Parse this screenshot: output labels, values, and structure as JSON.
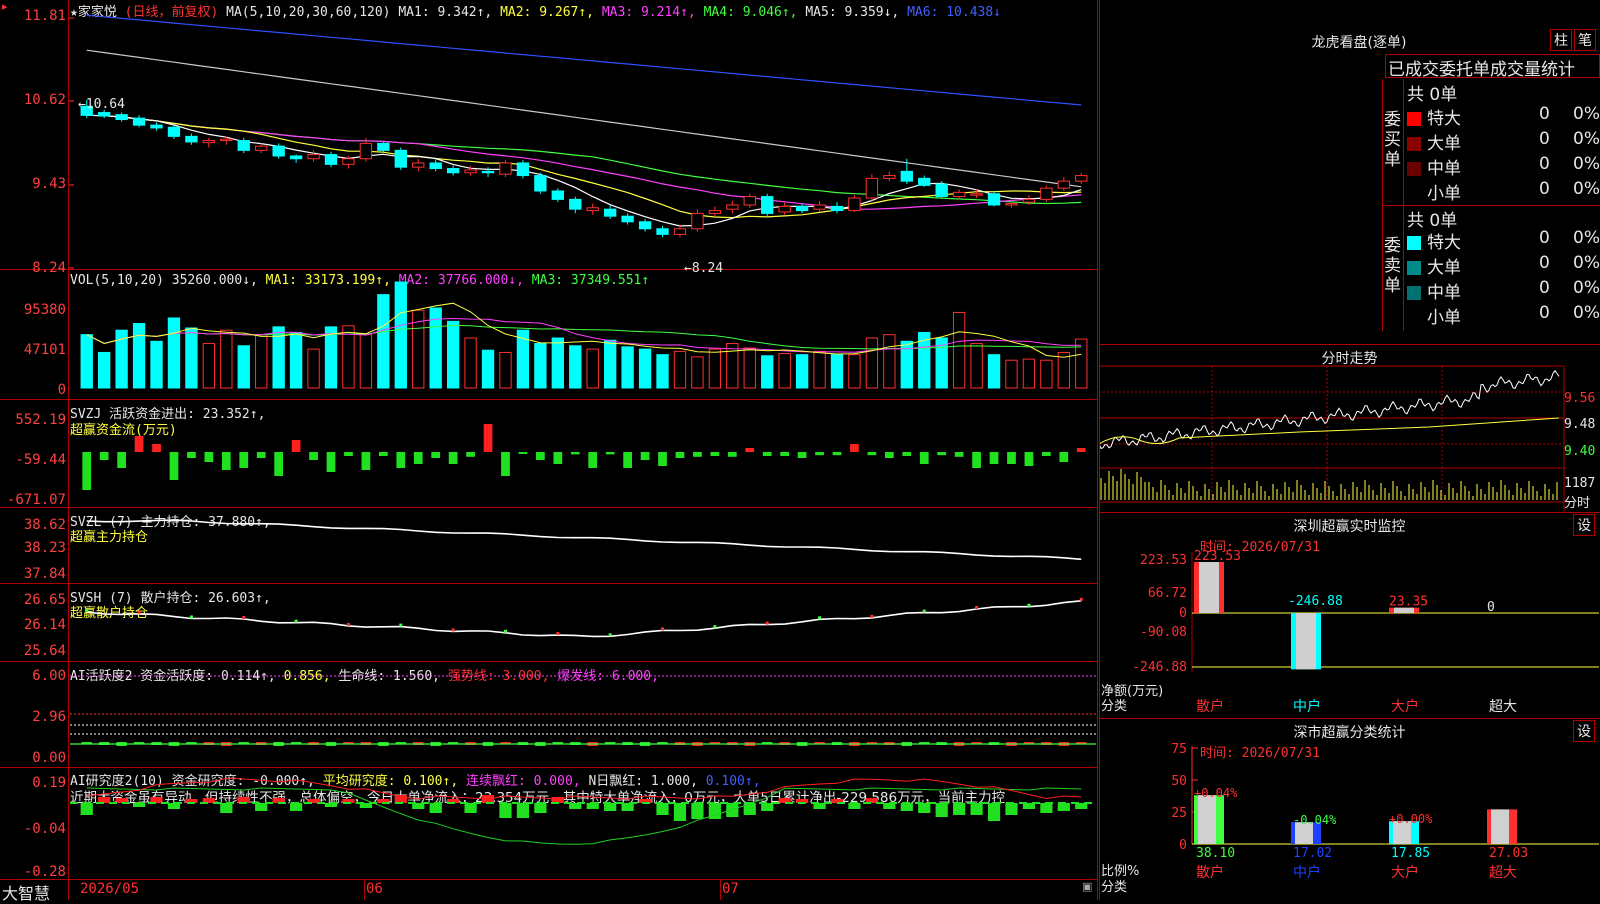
{
  "chart_header": {
    "stock_name": "★家家悦",
    "period": "(日线，前复权)",
    "ma_spec": "MA(5,10,20,30,60,120)",
    "ma_items": [
      {
        "label": "MA1: 9.342↑,",
        "color": "#e6e6e6"
      },
      {
        "label": "MA2: 9.267↑,",
        "color": "#ffff40"
      },
      {
        "label": "MA3: 9.214↑,",
        "color": "#ff40ff"
      },
      {
        "label": "MA4: 9.046↑,",
        "color": "#40ff40"
      },
      {
        "label": "MA5: 9.359↓,",
        "color": "#e6e6e6"
      },
      {
        "label": "MA6: 10.438↓",
        "color": "#4060ff"
      }
    ]
  },
  "price_axis": [
    "11.81",
    "10.62",
    "9.43",
    "8.24"
  ],
  "price_annotations": {
    "high": "←10.64",
    "low": "←8.24"
  },
  "vol_header": {
    "spec": "VOL(5,10,20)",
    "items": [
      {
        "label": "35260.000↓,",
        "color": "#e6e6e6"
      },
      {
        "label": "MA1: 33173.199↑,",
        "color": "#ffff40"
      },
      {
        "label": "MA2: 37766.000↓,",
        "color": "#ff40ff"
      },
      {
        "label": "MA3: 37349.551↑",
        "color": "#40ff40"
      }
    ]
  },
  "vol_axis": [
    "95380",
    "47101",
    "0"
  ],
  "svzj": {
    "title": "SVZJ  活跃资金进出: 23.352↑,",
    "sub": "超赢资金流(万元)",
    "axis": [
      "552.19",
      "-59.44",
      "-671.07"
    ]
  },
  "svzl": {
    "title": "SVZL (7) 主力持仓: 37.880↑,",
    "sub": "超赢主力持仓",
    "axis": [
      "38.62",
      "38.23",
      "37.84"
    ]
  },
  "svsh": {
    "title": "SVSH (7) 散户持仓: 26.603↑,",
    "sub": "超赢散户持仓",
    "axis": [
      "26.65",
      "26.14",
      "25.64"
    ]
  },
  "ai1": {
    "items": [
      {
        "label": "AI活跃度2 资金活跃度: 0.114↑,",
        "color": "#e6e6e6"
      },
      {
        "label": "0.856,",
        "color": "#ffff40"
      },
      {
        "label": "生命线: 1.560,",
        "color": "#e6e6e6"
      },
      {
        "label": "强势线: 3.000,",
        "color": "#ff3030"
      },
      {
        "label": "爆发线: 6.000,",
        "color": "#ff40ff"
      }
    ],
    "axis": [
      "6.00",
      "2.96",
      "0.00"
    ]
  },
  "ai2": {
    "items": [
      {
        "label": "AI研究度2(10) 资金研究度: -0.000↑,",
        "color": "#e6e6e6"
      },
      {
        "label": "平均研究度: 0.100↑,",
        "color": "#ffff40"
      },
      {
        "label": "连续飘红: 0.000,",
        "color": "#ff40ff"
      },
      {
        "label": "N日飘红: 1.000,",
        "color": "#e6e6e6"
      },
      {
        "label": "0.100↑,",
        "color": "#4060ff"
      }
    ],
    "note": "近期大资金虽有异动，但持续性不强，总体偏空，今日大单净流入：23.354万元，其中特大单净流入：0万元，大单5日累计净出-229.586万元，当前主力控",
    "axis": [
      "0.19",
      "-0.04",
      "-0.28"
    ]
  },
  "date_axis": {
    "brand": "大智慧",
    "labels": [
      "2026/05",
      "06",
      "07"
    ]
  },
  "right": {
    "title": "龙虎看盘(逐单)",
    "btn1": "柱",
    "btn2": "笔",
    "tab_title": "已成交委托单成交量统计",
    "buy_label": "委买单",
    "sell_label": "委卖单",
    "buy_total": "共 0单",
    "sell_total": "共 0单",
    "buy_rows": [
      {
        "name": "特大",
        "v": "0",
        "p": "0%",
        "color": "#ff0000"
      },
      {
        "name": "大单",
        "v": "0",
        "p": "0%",
        "color": "#8a0000"
      },
      {
        "name": "中单",
        "v": "0",
        "p": "0%",
        "color": "#6a0000"
      },
      {
        "name": "小单",
        "v": "0",
        "p": "0%",
        "color": "#000000"
      }
    ],
    "sell_rows": [
      {
        "name": "特大",
        "v": "0",
        "p": "0%",
        "color": "#00ffff"
      },
      {
        "name": "大单",
        "v": "0",
        "p": "0%",
        "color": "#008b8b"
      },
      {
        "name": "中单",
        "v": "0",
        "p": "0%",
        "color": "#007070"
      },
      {
        "name": "小单",
        "v": "0",
        "p": "0%",
        "color": "#000000"
      }
    ],
    "minute_title": "分时走势",
    "minute_axis": [
      "9.56",
      "9.48",
      "9.40"
    ],
    "minute_vol": "1187",
    "minute_vol_label": "分时",
    "monitor_title": "深圳超赢实时监控",
    "set1": "设",
    "monitor_time": "时间: 2026/07/31",
    "monitor_axis": [
      "223.53",
      "66.72",
      "0",
      "-90.08",
      "-246.88"
    ],
    "monitor_bar_labels": [
      "223.53",
      "-246.88",
      "23.35",
      "0"
    ],
    "monitor_ylabel": "净额(万元)",
    "monitor_xlabel": "分类",
    "categories": [
      "散户",
      "中户",
      "大户",
      "超大"
    ],
    "class_title": "深市超赢分类统计",
    "set2": "设",
    "class_time": "时间: 2026/07/31",
    "class_axis": [
      "75",
      "50",
      "25",
      "0"
    ],
    "class_pct": [
      "+0.04%",
      "-0.04%",
      "+0.00%",
      ""
    ],
    "class_values": [
      "38.10",
      "17.02",
      "17.85",
      "27.03"
    ],
    "class_ylabel": "比例%",
    "class_xlabel": "分类"
  },
  "chart_data": {
    "type": "candlestick",
    "candles": [
      [
        10.55,
        10.42,
        10.64,
        10.38
      ],
      [
        10.46,
        10.41,
        10.5,
        10.38
      ],
      [
        10.43,
        10.36,
        10.46,
        10.33
      ],
      [
        10.38,
        10.28,
        10.42,
        10.25
      ],
      [
        10.28,
        10.24,
        10.32,
        10.2
      ],
      [
        10.25,
        10.12,
        10.28,
        10.08
      ],
      [
        10.12,
        10.04,
        10.16,
        10.0
      ],
      [
        10.03,
        10.06,
        10.1,
        9.96
      ],
      [
        10.06,
        10.08,
        10.12,
        10.0
      ],
      [
        10.06,
        9.92,
        10.1,
        9.88
      ],
      [
        9.92,
        9.98,
        10.02,
        9.88
      ],
      [
        9.98,
        9.84,
        10.02,
        9.8
      ],
      [
        9.84,
        9.8,
        9.86,
        9.74
      ],
      [
        9.8,
        9.86,
        9.92,
        9.76
      ],
      [
        9.86,
        9.72,
        9.9,
        9.68
      ],
      [
        9.72,
        9.8,
        9.84,
        9.66
      ],
      [
        9.8,
        10.02,
        10.1,
        9.76
      ],
      [
        10.02,
        9.92,
        10.04,
        9.88
      ],
      [
        9.92,
        9.68,
        9.96,
        9.64
      ],
      [
        9.68,
        9.74,
        9.8,
        9.62
      ],
      [
        9.74,
        9.66,
        9.8,
        9.62
      ],
      [
        9.66,
        9.6,
        9.7,
        9.56
      ],
      [
        9.6,
        9.64,
        9.7,
        9.56
      ],
      [
        9.62,
        9.6,
        9.68,
        9.54
      ],
      [
        9.58,
        9.74,
        9.78,
        9.54
      ],
      [
        9.74,
        9.56,
        9.78,
        9.52
      ],
      [
        9.56,
        9.34,
        9.6,
        9.3
      ],
      [
        9.34,
        9.22,
        9.38,
        9.18
      ],
      [
        9.22,
        9.08,
        9.26,
        9.02
      ],
      [
        9.06,
        9.1,
        9.16,
        9.0
      ],
      [
        9.08,
        8.98,
        9.14,
        8.94
      ],
      [
        8.98,
        8.9,
        9.02,
        8.86
      ],
      [
        8.9,
        8.8,
        8.94,
        8.76
      ],
      [
        8.8,
        8.72,
        8.84,
        8.68
      ],
      [
        8.72,
        8.8,
        8.86,
        8.68
      ],
      [
        8.8,
        9.02,
        9.08,
        8.76
      ],
      [
        9.02,
        9.06,
        9.12,
        8.98
      ],
      [
        9.08,
        9.14,
        9.2,
        9.02
      ],
      [
        9.14,
        9.26,
        9.3,
        9.1
      ],
      [
        9.26,
        9.02,
        9.3,
        8.98
      ],
      [
        9.04,
        9.12,
        9.18,
        9.0
      ],
      [
        9.12,
        9.06,
        9.16,
        9.02
      ],
      [
        9.08,
        9.14,
        9.2,
        9.04
      ],
      [
        9.12,
        9.06,
        9.18,
        9.02
      ],
      [
        9.06,
        9.24,
        9.28,
        9.04
      ],
      [
        9.24,
        9.52,
        9.58,
        9.2
      ],
      [
        9.52,
        9.56,
        9.62,
        9.48
      ],
      [
        9.62,
        9.48,
        9.8,
        9.44
      ],
      [
        9.52,
        9.42,
        9.56,
        9.4
      ],
      [
        9.44,
        9.26,
        9.48,
        9.24
      ],
      [
        9.26,
        9.32,
        9.36,
        9.22
      ],
      [
        9.28,
        9.3,
        9.36,
        9.24
      ],
      [
        9.3,
        9.14,
        9.34,
        9.12
      ],
      [
        9.14,
        9.16,
        9.22,
        9.1
      ],
      [
        9.18,
        9.22,
        9.28,
        9.14
      ],
      [
        9.22,
        9.38,
        9.42,
        9.18
      ],
      [
        9.38,
        9.48,
        9.54,
        9.34
      ],
      [
        9.48,
        9.56,
        9.6,
        9.44
      ]
    ],
    "volume": [
      48000,
      32000,
      52000,
      58000,
      42000,
      63000,
      54000,
      40000,
      52000,
      38000,
      48000,
      55000,
      50000,
      35000,
      55000,
      56000,
      48000,
      84000,
      95380,
      70000,
      72000,
      60000,
      45000,
      34000,
      32000,
      52000,
      40000,
      45000,
      38000,
      35000,
      43000,
      37000,
      35000,
      30000,
      33000,
      28000,
      35000,
      40000,
      36000,
      29000,
      31000,
      30000,
      33000,
      30000,
      30000,
      45000,
      48000,
      42000,
      50000,
      45000,
      68000,
      40000,
      30000,
      25000,
      26000,
      25000,
      32000,
      44000
    ],
    "ylim": [
      8.24,
      11.81
    ]
  }
}
